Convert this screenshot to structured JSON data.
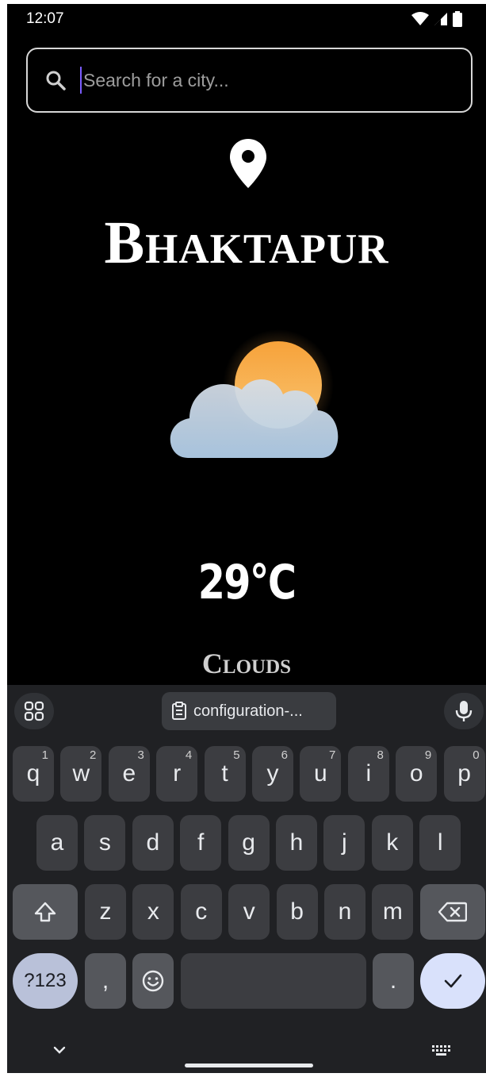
{
  "status_bar": {
    "time": "12:07",
    "icons": [
      "wifi-icon",
      "cell-signal-icon",
      "battery-icon"
    ]
  },
  "search": {
    "placeholder": "Search for a city...",
    "value": ""
  },
  "weather": {
    "city": "Bhaktapur",
    "temperature": "29°C",
    "condition": "Clouds",
    "icon": "cloud-sun-icon"
  },
  "keyboard": {
    "clipboard_chip": "configuration-...",
    "row1": [
      {
        "k": "q",
        "s": "1"
      },
      {
        "k": "w",
        "s": "2"
      },
      {
        "k": "e",
        "s": "3"
      },
      {
        "k": "r",
        "s": "4"
      },
      {
        "k": "t",
        "s": "5"
      },
      {
        "k": "y",
        "s": "6"
      },
      {
        "k": "u",
        "s": "7"
      },
      {
        "k": "i",
        "s": "8"
      },
      {
        "k": "o",
        "s": "9"
      },
      {
        "k": "p",
        "s": "0"
      }
    ],
    "row2": [
      "a",
      "s",
      "d",
      "f",
      "g",
      "h",
      "j",
      "k",
      "l"
    ],
    "row3": [
      "z",
      "x",
      "c",
      "v",
      "b",
      "n",
      "m"
    ],
    "symbols_label": "?123",
    "comma": ",",
    "period": "."
  },
  "colors": {
    "background": "#000000",
    "keyboard_bg": "#202124",
    "key_bg": "#3c3d41",
    "accent_enter": "#d9e1fb",
    "cursor": "#7a5cff"
  }
}
